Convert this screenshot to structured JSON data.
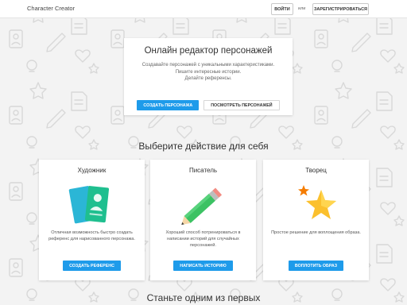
{
  "header": {
    "brand": "Character Creator",
    "login_label": "Войти",
    "or_label": "или",
    "register_label": "Зарегистрироваться"
  },
  "hero": {
    "title": "Онлайн редактор персонажей",
    "lines": [
      "Создавайте персонажей с уникальными характеристиками.",
      "Пишите интересные истории.",
      "Делайте референсы."
    ],
    "create_label": "Создать персонажа",
    "view_label": "Посмотреть персонажей"
  },
  "choose_title": "Выберите действие для себя",
  "cards": [
    {
      "title": "Художник",
      "desc": "Отличная возможность быстро создать референс для нарисованного персонажа.",
      "button": "Создать референс",
      "icon": "id-cards-icon"
    },
    {
      "title": "Писатель",
      "desc": "Хороший способ потренироваться в написании историй для случайных персонажей.",
      "button": "Написать историю",
      "icon": "pencil-icon"
    },
    {
      "title": "Творец",
      "desc": "Простое решение для воплощения образа.",
      "button": "Воплотить образ",
      "icon": "stars-icon"
    }
  ],
  "become_title": "Станьте одним из первых",
  "colors": {
    "accent": "#1e9bea",
    "background": "#f3f3f3",
    "card_green": "#1fbf8f",
    "pencil_green": "#3cc263",
    "star_yellow": "#fbc02d"
  }
}
